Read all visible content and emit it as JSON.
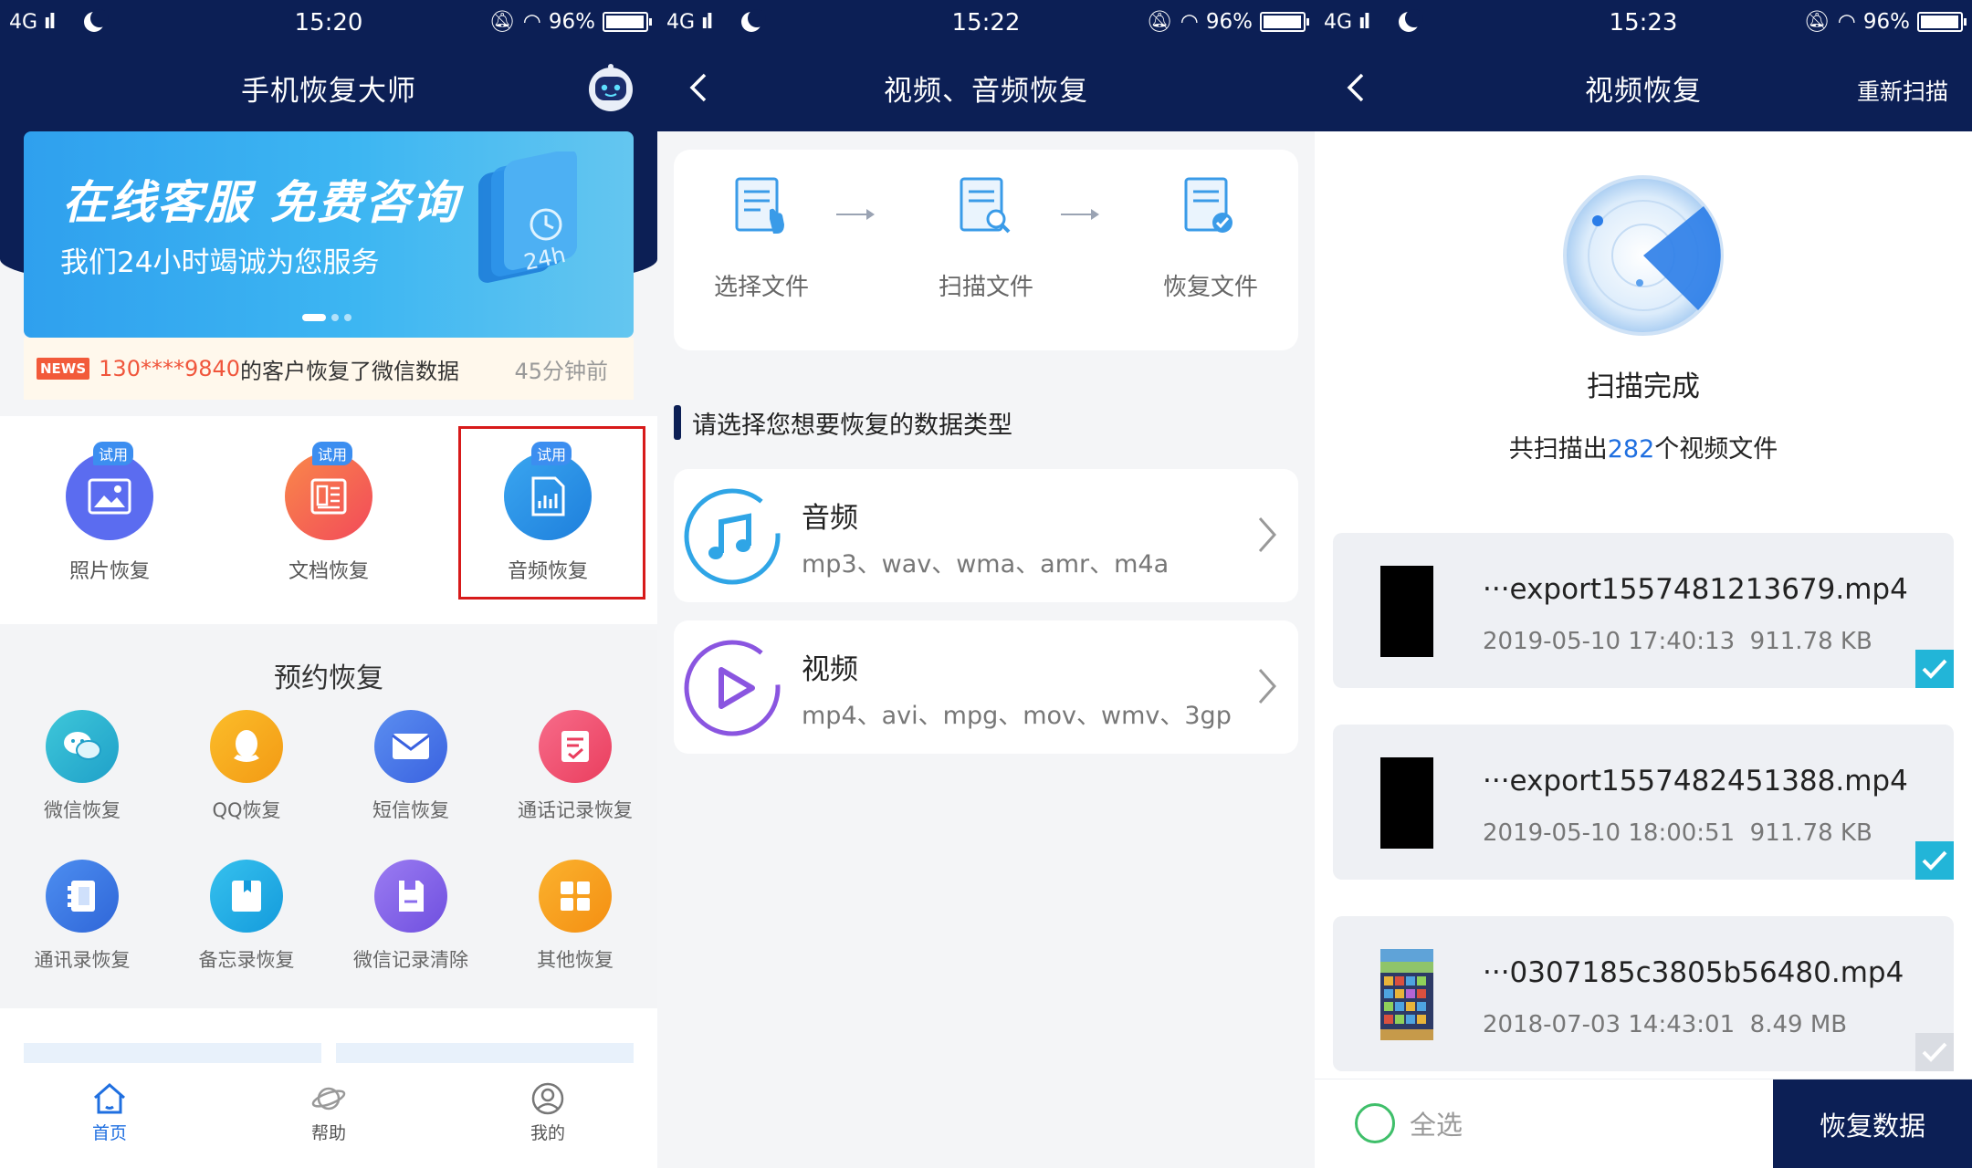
{
  "status_bars": [
    {
      "network": "4G",
      "time": "15:20",
      "battery": "96%"
    },
    {
      "network": "4G",
      "time": "15:22",
      "battery": "96%"
    },
    {
      "network": "4G",
      "time": "15:23",
      "battery": "96%"
    }
  ],
  "home": {
    "title": "手机恢复大师",
    "banner": {
      "headline": "在线客服  免费咨询",
      "subline": "我们24小时竭诚为您服务"
    },
    "news": {
      "tag": "NEWS",
      "phone": "130****9840",
      "message": "的客户恢复了微信数据",
      "ago": "45分钟前"
    },
    "features": [
      {
        "label": "照片恢复",
        "badge": "试用",
        "icon": "photo-icon",
        "color": "#5b6cf0"
      },
      {
        "label": "文档恢复",
        "badge": "试用",
        "icon": "document-icon",
        "color": "#f5604a"
      },
      {
        "label": "音频恢复",
        "badge": "试用",
        "icon": "audio-chart-icon",
        "color": "#2a8fe6"
      }
    ],
    "reserve_title": "预约恢复",
    "grid": [
      {
        "label": "微信恢复",
        "icon": "wechat-icon",
        "color": "#28b3d2"
      },
      {
        "label": "QQ恢复",
        "icon": "qq-icon",
        "color": "#f6a31c"
      },
      {
        "label": "短信恢复",
        "icon": "envelope-icon",
        "color": "#4a78ea"
      },
      {
        "label": "通话记录恢复",
        "icon": "call-log-icon",
        "color": "#f0506e"
      },
      {
        "label": "通讯录恢复",
        "icon": "contacts-icon",
        "color": "#3778e8"
      },
      {
        "label": "备忘录恢复",
        "icon": "memo-icon",
        "color": "#1fa9e6"
      },
      {
        "label": "微信记录清除",
        "icon": "clean-icon",
        "color": "#7f64ea"
      },
      {
        "label": "其他恢复",
        "icon": "grid-icon",
        "color": "#f5a01e"
      }
    ],
    "tabs": [
      {
        "label": "首页",
        "icon": "home-icon",
        "active": true
      },
      {
        "label": "帮助",
        "icon": "planet-icon",
        "active": false
      },
      {
        "label": "我的",
        "icon": "user-icon",
        "active": false
      }
    ]
  },
  "media": {
    "title": "视频、音频恢复",
    "steps": [
      "选择文件",
      "扫描文件",
      "恢复文件"
    ],
    "section_label": "请选择您想要恢复的数据类型",
    "types": [
      {
        "name": "音频",
        "extensions": "mp3、wav、wma、amr、m4a",
        "icon": "music-note-icon",
        "color": "#2fa5e6"
      },
      {
        "name": "视频",
        "extensions": "mp4、avi、mpg、mov、wmv、3gp",
        "icon": "play-icon",
        "color": "#8a55e0"
      }
    ]
  },
  "video": {
    "title": "视频恢复",
    "action": "重新扫描",
    "scan_status": "扫描完成",
    "summary_prefix": "共扫描出",
    "summary_count": "282",
    "summary_suffix": "个视频文件",
    "files": [
      {
        "name": "···export1557481213679.mp4",
        "date": "2019-05-10 17:40:13",
        "size": "911.78 KB",
        "checked": true
      },
      {
        "name": "···export1557482451388.mp4",
        "date": "2019-05-10 18:00:51",
        "size": "911.78 KB",
        "checked": true
      },
      {
        "name": "···0307185c3805b56480.mp4",
        "date": "2018-07-03 14:43:01",
        "size": "8.49 MB",
        "checked": false
      }
    ],
    "select_all": "全选",
    "recover_button": "恢复数据"
  },
  "colors": {
    "navy": "#0c1f55",
    "accent_blue": "#1f6fe0",
    "check_teal": "#22b5d8",
    "highlight_red": "#d71a1a"
  }
}
